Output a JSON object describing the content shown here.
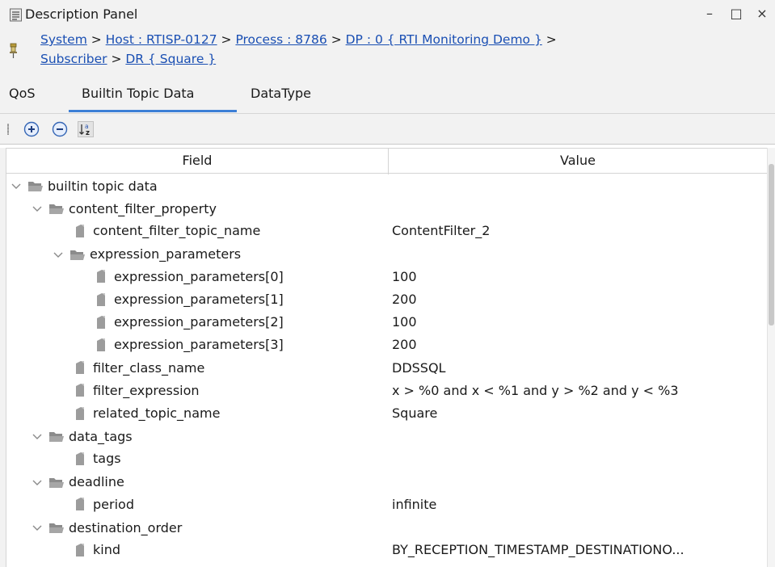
{
  "window": {
    "title": "Description Panel",
    "minimize": "–",
    "maximize": "□",
    "close": "×"
  },
  "breadcrumb": {
    "line1": [
      {
        "text": "System",
        "link": true
      },
      {
        "text": " > ",
        "link": false
      },
      {
        "text": "Host : RTISP-0127",
        "link": true
      },
      {
        "text": " > ",
        "link": false
      },
      {
        "text": "Process : 8786",
        "link": true
      },
      {
        "text": " > ",
        "link": false
      },
      {
        "text": "DP : 0 { RTI Monitoring Demo }",
        "link": true
      },
      {
        "text": " >",
        "link": false
      }
    ],
    "line2": [
      {
        "text": "Subscriber",
        "link": true
      },
      {
        "text": " > ",
        "link": false
      },
      {
        "text": "DR { Square }",
        "link": true
      }
    ]
  },
  "tabs": [
    {
      "label": "QoS",
      "active": false
    },
    {
      "label": "Builtin Topic Data",
      "active": true
    },
    {
      "label": "DataType",
      "active": false
    }
  ],
  "toolbar": {
    "expand_icon": "expand-all-icon",
    "collapse_icon": "collapse-all-icon",
    "sort_icon": "sort-az-icon"
  },
  "table": {
    "columns": [
      "Field",
      "Value"
    ],
    "rows": [
      {
        "depth": 0,
        "type": "node",
        "field": "builtin topic data",
        "value": ""
      },
      {
        "depth": 1,
        "type": "node",
        "field": "content_filter_property",
        "value": ""
      },
      {
        "depth": 2,
        "type": "leaf",
        "field": "content_filter_topic_name",
        "value": "ContentFilter_2"
      },
      {
        "depth": 2,
        "type": "node",
        "field": "expression_parameters",
        "value": ""
      },
      {
        "depth": 3,
        "type": "leaf",
        "field": "expression_parameters[0]",
        "value": "100"
      },
      {
        "depth": 3,
        "type": "leaf",
        "field": "expression_parameters[1]",
        "value": "200"
      },
      {
        "depth": 3,
        "type": "leaf",
        "field": "expression_parameters[2]",
        "value": "100"
      },
      {
        "depth": 3,
        "type": "leaf",
        "field": "expression_parameters[3]",
        "value": "200"
      },
      {
        "depth": 2,
        "type": "leaf",
        "field": "filter_class_name",
        "value": "DDSSQL"
      },
      {
        "depth": 2,
        "type": "leaf",
        "field": "filter_expression",
        "value": "x > %0 and x < %1 and y > %2 and y < %3"
      },
      {
        "depth": 2,
        "type": "leaf",
        "field": "related_topic_name",
        "value": "Square"
      },
      {
        "depth": 1,
        "type": "node",
        "field": "data_tags",
        "value": ""
      },
      {
        "depth": 2,
        "type": "leaf",
        "field": "tags",
        "value": ""
      },
      {
        "depth": 1,
        "type": "node",
        "field": "deadline",
        "value": ""
      },
      {
        "depth": 2,
        "type": "leaf",
        "field": "period",
        "value": "infinite"
      },
      {
        "depth": 1,
        "type": "node",
        "field": "destination_order",
        "value": ""
      },
      {
        "depth": 2,
        "type": "leaf",
        "field": "kind",
        "value": "BY_RECEPTION_TIMESTAMP_DESTINATIONO..."
      }
    ]
  }
}
